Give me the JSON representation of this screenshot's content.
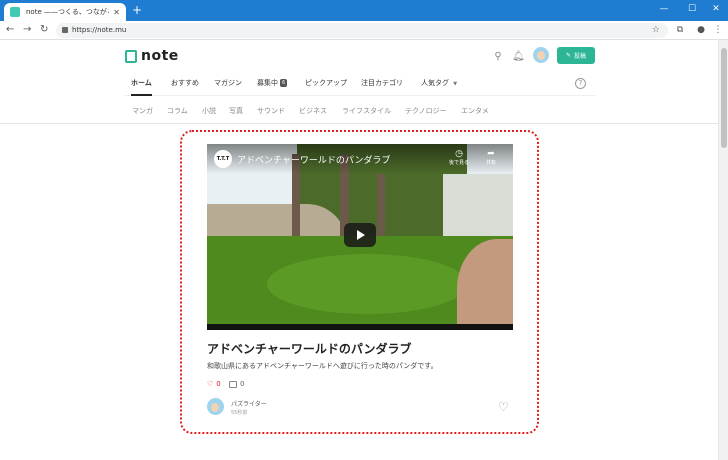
{
  "browser": {
    "tab_title": "note ——つくる、つながる、とどける。",
    "url": "https://note.mu"
  },
  "header": {
    "logo_text": "note",
    "post_button": "投稿"
  },
  "main_nav": {
    "items": [
      {
        "label": "ホーム",
        "active": true
      },
      {
        "label": "おすすめ"
      },
      {
        "label": "マガジン"
      },
      {
        "label": "募集中",
        "badge": "6"
      },
      {
        "label": "ピックアップ"
      },
      {
        "label": "注目カテゴリ"
      },
      {
        "label": "人気タグ",
        "dropdown": true
      }
    ]
  },
  "sub_nav": {
    "items": [
      "マンガ",
      "コラム",
      "小説",
      "写真",
      "サウンド",
      "ビジネス",
      "ライフスタイル",
      "テクノロジー",
      "エンタメ"
    ]
  },
  "video": {
    "channel_badge": "T.T.T",
    "title": "アドベンチャーワールドのパンダラブ",
    "watch_later": "後で見る",
    "share": "共有"
  },
  "article": {
    "title": "アドベンチャーワールドのパンダラブ",
    "description": "和歌山県にあるアドベンチャーワールドへ遊びに行った時のパンダです。",
    "likes": "0",
    "comments": "0",
    "author": "パズライター",
    "time": "55秒前"
  },
  "colors": {
    "brand": "#2cb696",
    "titlebar": "#1f7cd1",
    "highlight": "#e0191b"
  }
}
